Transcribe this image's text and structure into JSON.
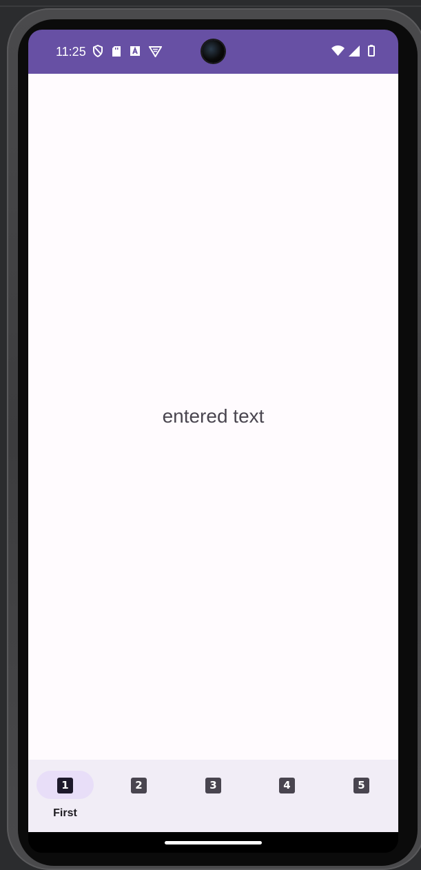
{
  "status_bar": {
    "time": "11:25",
    "left_icons": [
      "shield-icon",
      "sd-card-icon",
      "font-a-icon",
      "vpn-shield-icon"
    ],
    "right_icons": [
      "wifi-icon",
      "cell-signal-icon",
      "battery-icon"
    ],
    "background_color": "#6750a4"
  },
  "main": {
    "text": "entered text"
  },
  "bottom_nav": {
    "items": [
      {
        "icon_glyph": "1",
        "label": "First",
        "selected": true
      },
      {
        "icon_glyph": "2",
        "label": "",
        "selected": false
      },
      {
        "icon_glyph": "3",
        "label": "",
        "selected": false
      },
      {
        "icon_glyph": "4",
        "label": "",
        "selected": false
      },
      {
        "icon_glyph": "5",
        "label": "",
        "selected": false
      }
    ],
    "indicator_color": "#e8def8"
  }
}
